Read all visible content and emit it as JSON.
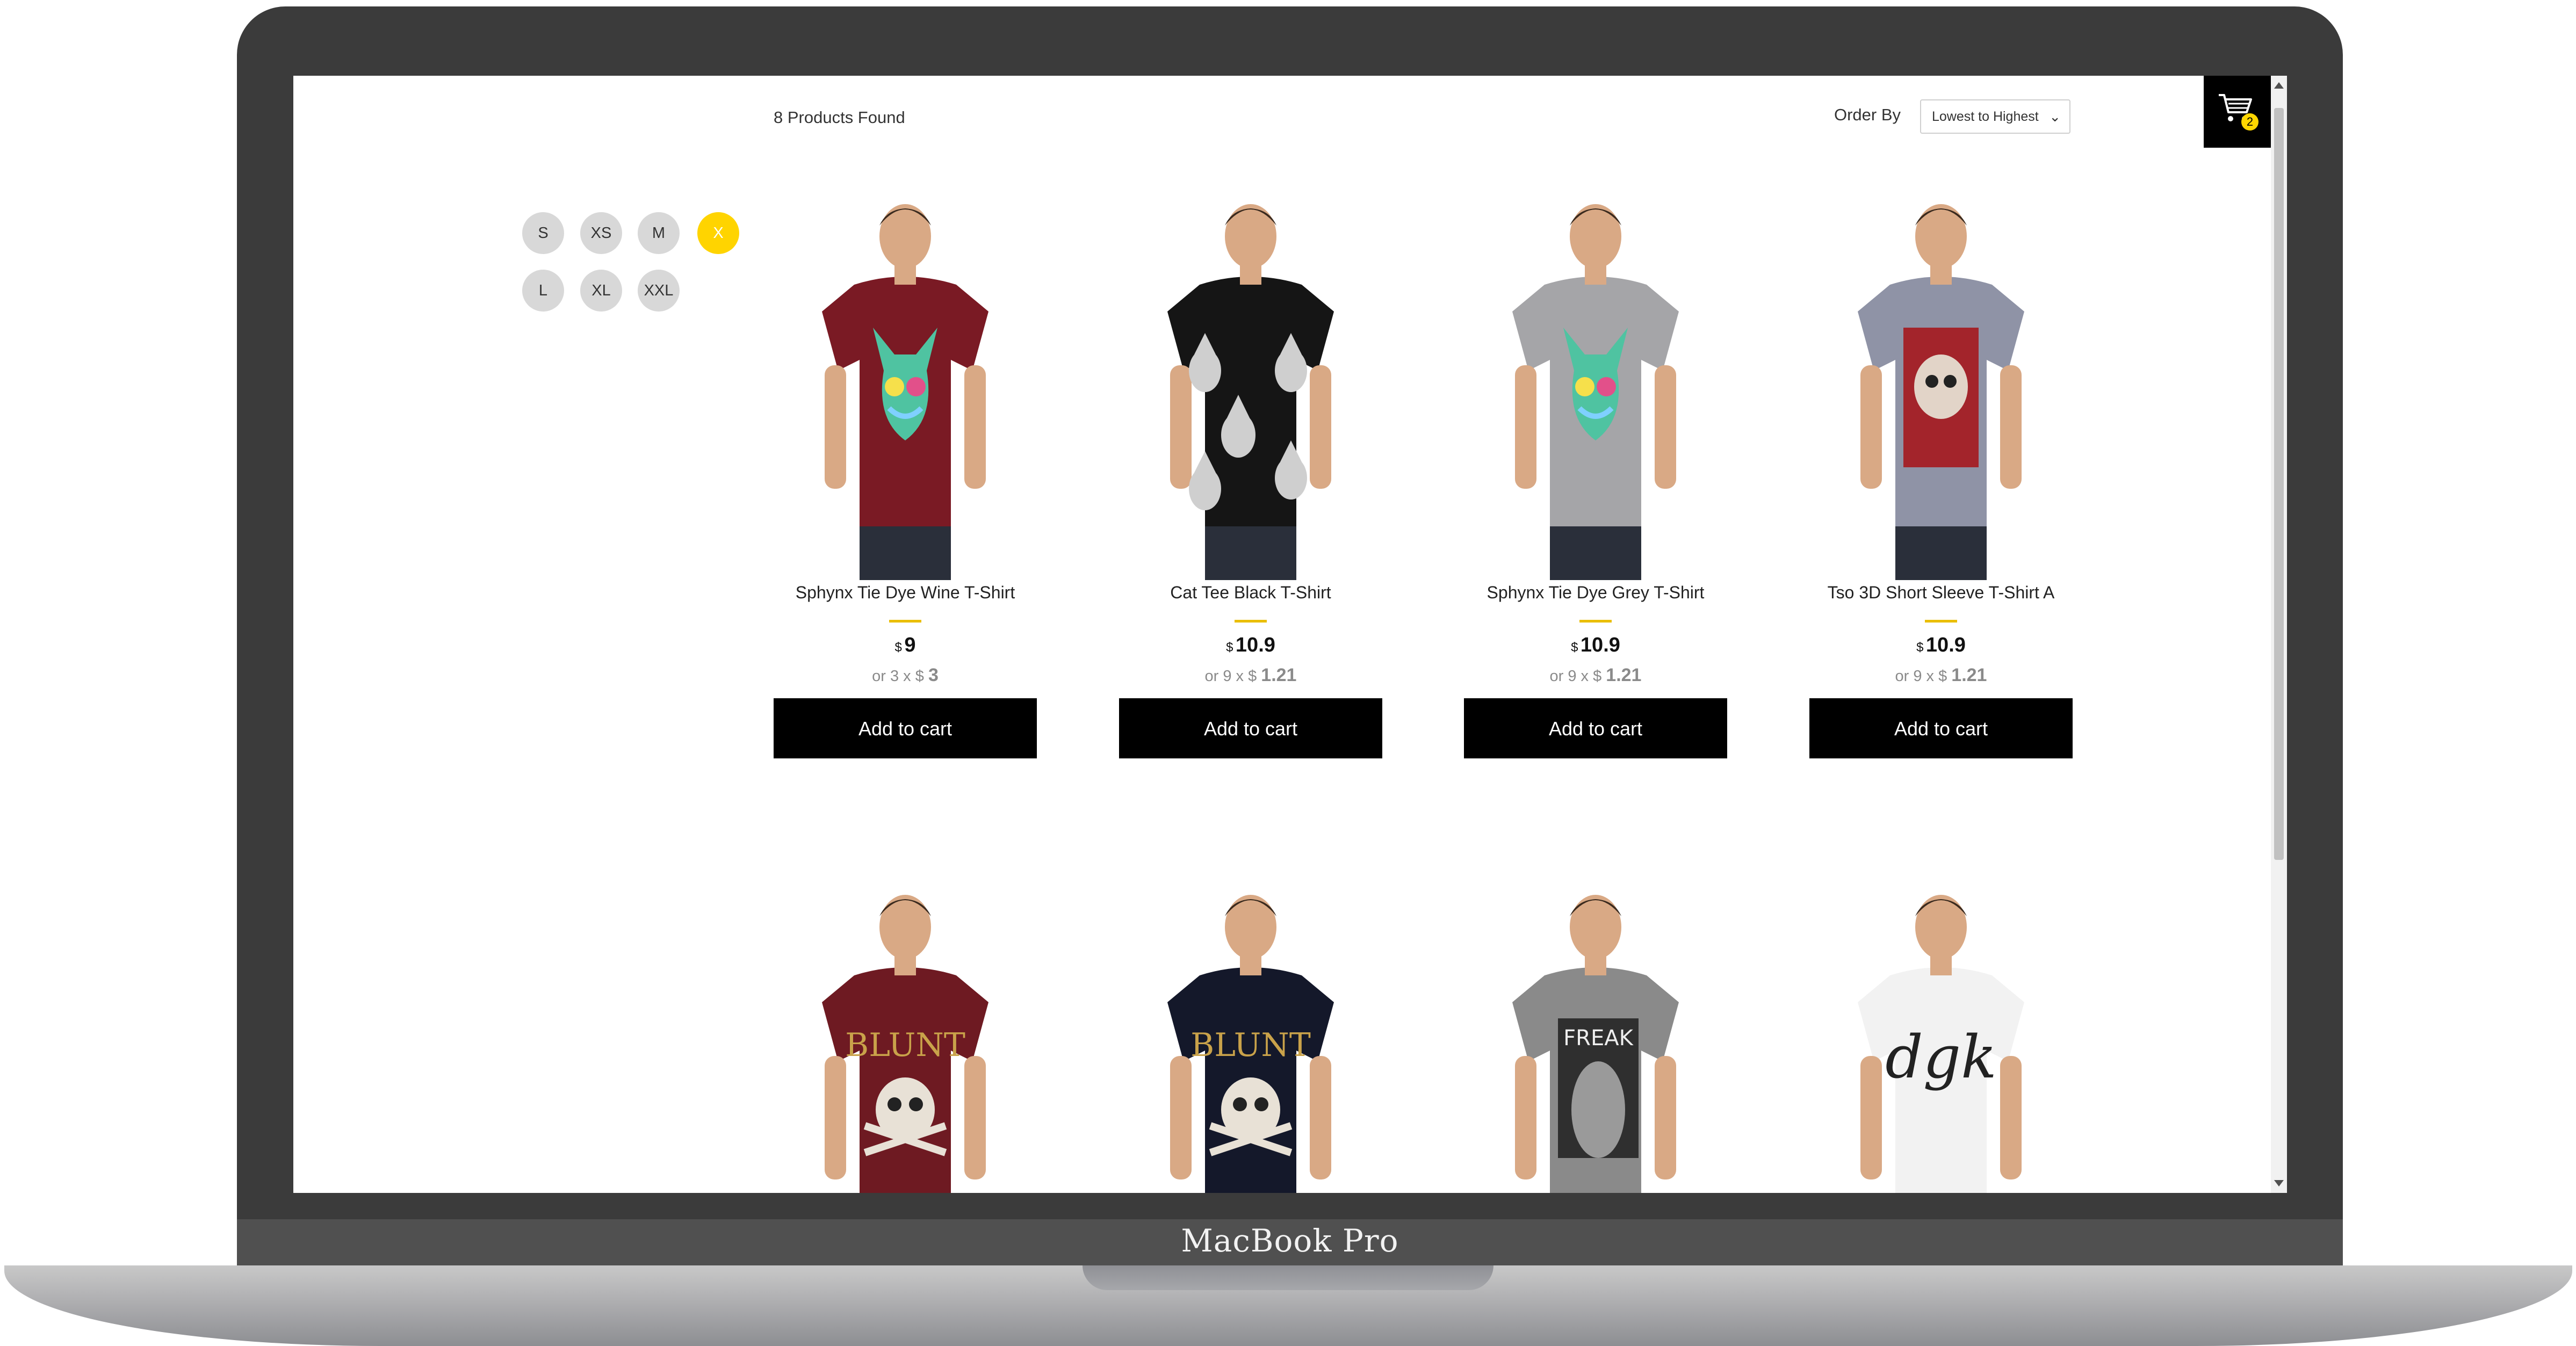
{
  "device": {
    "label": "MacBook Pro"
  },
  "header": {
    "products_found": "8 Products Found",
    "order_by_label": "Order By",
    "order_by_selected": "Lowest to Highest",
    "cart_count": "2"
  },
  "sizes": [
    {
      "label": "S",
      "active": false
    },
    {
      "label": "XS",
      "active": false
    },
    {
      "label": "M",
      "active": false
    },
    {
      "label": "X",
      "active": true
    },
    {
      "label": "L",
      "active": false
    },
    {
      "label": "XL",
      "active": false
    },
    {
      "label": "XXL",
      "active": false
    }
  ],
  "products": [
    {
      "name": "Sphynx Tie Dye Wine T-Shirt",
      "currency": "$",
      "price": "9",
      "installment_prefix": "or 3 x",
      "installment_currency": "$",
      "installment_value": "3",
      "cta": "Add to cart",
      "shirt_color": "#7a1a24",
      "print": "cat-colorful"
    },
    {
      "name": "Cat Tee Black T-Shirt",
      "currency": "$",
      "price": "10.9",
      "installment_prefix": "or 9 x",
      "installment_currency": "$",
      "installment_value": "1.21",
      "cta": "Add to cart",
      "shirt_color": "#151515",
      "print": "cat-allover"
    },
    {
      "name": "Sphynx Tie Dye Grey T-Shirt",
      "currency": "$",
      "price": "10.9",
      "installment_prefix": "or 9 x",
      "installment_currency": "$",
      "installment_value": "1.21",
      "cta": "Add to cart",
      "shirt_color": "#a5a5a8",
      "print": "cat-colorful"
    },
    {
      "name": "Tso 3D Short Sleeve T-Shirt A",
      "currency": "$",
      "price": "10.9",
      "installment_prefix": "or 9 x",
      "installment_currency": "$",
      "installment_value": "1.21",
      "cta": "Add to cart",
      "shirt_color": "#8f93a6",
      "print": "skull-red"
    },
    {
      "shirt_color": "#6e1a22",
      "print": "skull-blunt"
    },
    {
      "shirt_color": "#14182a",
      "print": "skull-blunt"
    },
    {
      "shirt_color": "#8a8a8a",
      "print": "photo-print"
    },
    {
      "shirt_color": "#f2f2f2",
      "print": "dgk-script"
    }
  ],
  "colors": {
    "accent": "#ffd400",
    "button": "#000000",
    "bezel": "#3b3b3b"
  }
}
